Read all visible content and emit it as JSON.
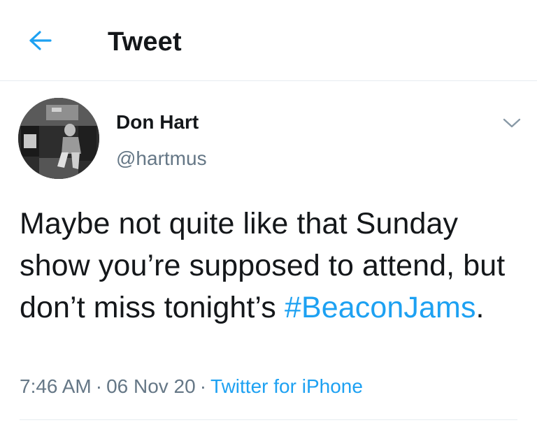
{
  "header": {
    "back_icon": "arrow-left-icon",
    "title": "Tweet"
  },
  "tweet": {
    "author": {
      "name": "Don Hart",
      "handle": "@hartmus",
      "avatar_icon": "profile-photo"
    },
    "more_icon": "chevron-down-icon",
    "text_before": "Maybe not quite like that Sunday show you’re supposed to attend, but don’t miss tonight’s ",
    "hashtag": "#BeaconJams",
    "text_after": ".",
    "time": "7:46 AM",
    "date": "06 Nov 20",
    "separator": "·",
    "source": "Twitter for iPhone"
  },
  "colors": {
    "accent": "#1da1f2",
    "text": "#14171a",
    "secondary": "#657786",
    "divider": "#e6ecf0"
  }
}
